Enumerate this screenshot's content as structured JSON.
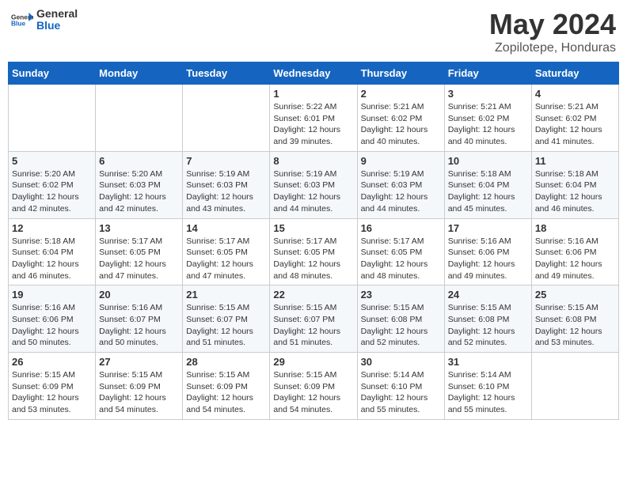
{
  "header": {
    "logo_general": "General",
    "logo_blue": "Blue",
    "month_title": "May 2024",
    "location": "Zopilotepe, Honduras"
  },
  "days_of_week": [
    "Sunday",
    "Monday",
    "Tuesday",
    "Wednesday",
    "Thursday",
    "Friday",
    "Saturday"
  ],
  "weeks": [
    [
      {
        "day": "",
        "info": ""
      },
      {
        "day": "",
        "info": ""
      },
      {
        "day": "",
        "info": ""
      },
      {
        "day": "1",
        "sunrise": "5:22 AM",
        "sunset": "6:01 PM",
        "daylight": "12 hours and 39 minutes."
      },
      {
        "day": "2",
        "sunrise": "5:21 AM",
        "sunset": "6:02 PM",
        "daylight": "12 hours and 40 minutes."
      },
      {
        "day": "3",
        "sunrise": "5:21 AM",
        "sunset": "6:02 PM",
        "daylight": "12 hours and 40 minutes."
      },
      {
        "day": "4",
        "sunrise": "5:21 AM",
        "sunset": "6:02 PM",
        "daylight": "12 hours and 41 minutes."
      }
    ],
    [
      {
        "day": "5",
        "sunrise": "5:20 AM",
        "sunset": "6:02 PM",
        "daylight": "12 hours and 42 minutes."
      },
      {
        "day": "6",
        "sunrise": "5:20 AM",
        "sunset": "6:03 PM",
        "daylight": "12 hours and 42 minutes."
      },
      {
        "day": "7",
        "sunrise": "5:19 AM",
        "sunset": "6:03 PM",
        "daylight": "12 hours and 43 minutes."
      },
      {
        "day": "8",
        "sunrise": "5:19 AM",
        "sunset": "6:03 PM",
        "daylight": "12 hours and 44 minutes."
      },
      {
        "day": "9",
        "sunrise": "5:19 AM",
        "sunset": "6:03 PM",
        "daylight": "12 hours and 44 minutes."
      },
      {
        "day": "10",
        "sunrise": "5:18 AM",
        "sunset": "6:04 PM",
        "daylight": "12 hours and 45 minutes."
      },
      {
        "day": "11",
        "sunrise": "5:18 AM",
        "sunset": "6:04 PM",
        "daylight": "12 hours and 46 minutes."
      }
    ],
    [
      {
        "day": "12",
        "sunrise": "5:18 AM",
        "sunset": "6:04 PM",
        "daylight": "12 hours and 46 minutes."
      },
      {
        "day": "13",
        "sunrise": "5:17 AM",
        "sunset": "6:05 PM",
        "daylight": "12 hours and 47 minutes."
      },
      {
        "day": "14",
        "sunrise": "5:17 AM",
        "sunset": "6:05 PM",
        "daylight": "12 hours and 47 minutes."
      },
      {
        "day": "15",
        "sunrise": "5:17 AM",
        "sunset": "6:05 PM",
        "daylight": "12 hours and 48 minutes."
      },
      {
        "day": "16",
        "sunrise": "5:17 AM",
        "sunset": "6:05 PM",
        "daylight": "12 hours and 48 minutes."
      },
      {
        "day": "17",
        "sunrise": "5:16 AM",
        "sunset": "6:06 PM",
        "daylight": "12 hours and 49 minutes."
      },
      {
        "day": "18",
        "sunrise": "5:16 AM",
        "sunset": "6:06 PM",
        "daylight": "12 hours and 49 minutes."
      }
    ],
    [
      {
        "day": "19",
        "sunrise": "5:16 AM",
        "sunset": "6:06 PM",
        "daylight": "12 hours and 50 minutes."
      },
      {
        "day": "20",
        "sunrise": "5:16 AM",
        "sunset": "6:07 PM",
        "daylight": "12 hours and 50 minutes."
      },
      {
        "day": "21",
        "sunrise": "5:15 AM",
        "sunset": "6:07 PM",
        "daylight": "12 hours and 51 minutes."
      },
      {
        "day": "22",
        "sunrise": "5:15 AM",
        "sunset": "6:07 PM",
        "daylight": "12 hours and 51 minutes."
      },
      {
        "day": "23",
        "sunrise": "5:15 AM",
        "sunset": "6:08 PM",
        "daylight": "12 hours and 52 minutes."
      },
      {
        "day": "24",
        "sunrise": "5:15 AM",
        "sunset": "6:08 PM",
        "daylight": "12 hours and 52 minutes."
      },
      {
        "day": "25",
        "sunrise": "5:15 AM",
        "sunset": "6:08 PM",
        "daylight": "12 hours and 53 minutes."
      }
    ],
    [
      {
        "day": "26",
        "sunrise": "5:15 AM",
        "sunset": "6:09 PM",
        "daylight": "12 hours and 53 minutes."
      },
      {
        "day": "27",
        "sunrise": "5:15 AM",
        "sunset": "6:09 PM",
        "daylight": "12 hours and 54 minutes."
      },
      {
        "day": "28",
        "sunrise": "5:15 AM",
        "sunset": "6:09 PM",
        "daylight": "12 hours and 54 minutes."
      },
      {
        "day": "29",
        "sunrise": "5:15 AM",
        "sunset": "6:09 PM",
        "daylight": "12 hours and 54 minutes."
      },
      {
        "day": "30",
        "sunrise": "5:14 AM",
        "sunset": "6:10 PM",
        "daylight": "12 hours and 55 minutes."
      },
      {
        "day": "31",
        "sunrise": "5:14 AM",
        "sunset": "6:10 PM",
        "daylight": "12 hours and 55 minutes."
      },
      {
        "day": "",
        "info": ""
      }
    ]
  ],
  "labels": {
    "sunrise": "Sunrise:",
    "sunset": "Sunset:",
    "daylight": "Daylight:"
  }
}
